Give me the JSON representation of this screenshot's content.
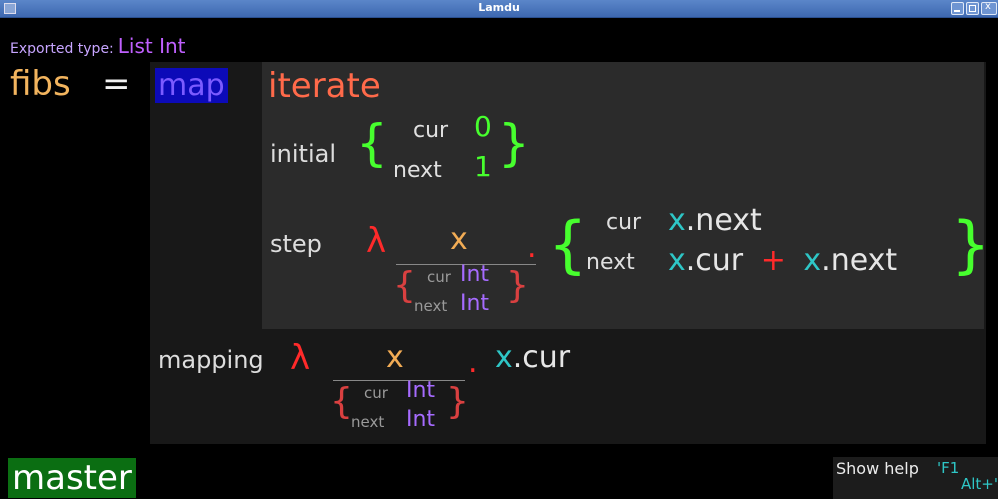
{
  "window": {
    "title": "Lamdu"
  },
  "exported": {
    "label": "Exported type:",
    "value": "List Int"
  },
  "definition": {
    "name": "fibs",
    "eq": "="
  },
  "map": {
    "keyword": "map"
  },
  "iterate": {
    "keyword": "iterate",
    "initial": {
      "label": "initial",
      "cur_label": "cur",
      "cur_val": "0",
      "next_label": "next",
      "next_val": "1"
    },
    "step": {
      "label": "step",
      "lambda": "λ",
      "param": "x",
      "dot": ".",
      "type_cur_label": "cur",
      "type_cur_val": "Int",
      "type_next_label": "next",
      "type_next_val": "Int",
      "cur_label": "cur",
      "cur_var": "x",
      "cur_field": ".next",
      "next_label": "next",
      "next_var1": "x",
      "next_field1": ".cur",
      "plus": "+",
      "next_var2": "x",
      "next_field2": ".next"
    }
  },
  "mapping": {
    "label": "mapping",
    "lambda": "λ",
    "param": "x",
    "dot": ".",
    "type_cur_label": "cur",
    "type_cur_val": "Int",
    "type_next_label": "next",
    "type_next_val": "Int",
    "body_var": "x",
    "body_field": ".cur"
  },
  "status": {
    "branch": "master",
    "help": "Show help",
    "key1": "'F1",
    "key2": "Alt+'"
  },
  "colors": {
    "titlebar": "#4a76bd",
    "branch_bg": "#0b6e12",
    "map_bg": "#0c0ab8"
  }
}
